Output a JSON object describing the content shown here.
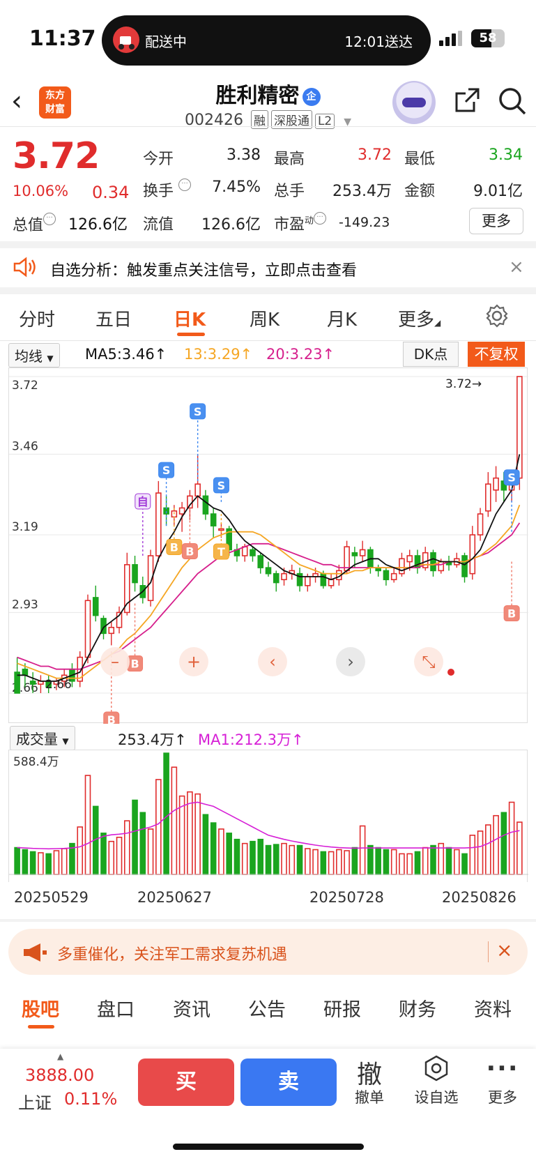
{
  "status": {
    "time": "11:37",
    "delivery": "配送中",
    "eta": "12:01送达",
    "battery": "58"
  },
  "header": {
    "logo_line1": "东方",
    "logo_line2": "财富",
    "name": "胜利精密",
    "cert": "企",
    "code": "002426",
    "tags": [
      "融",
      "深股通",
      "L2"
    ]
  },
  "quote": {
    "price": "3.72",
    "pct": "10.06%",
    "change": "0.34",
    "open_label": "今开",
    "open": "3.38",
    "high_label": "最高",
    "high": "3.72",
    "low_label": "最低",
    "low": "3.34",
    "turnover_label": "换手",
    "turnover": "7.45%",
    "volume_label": "总手",
    "volume": "253.4万",
    "amount_label": "金额",
    "amount": "9.01亿",
    "mktcap_label": "总值",
    "mktcap": "126.6亿",
    "float_label": "流值",
    "float": "126.6亿",
    "pe_label": "市盈",
    "pe_sup": "动",
    "pe": "-149.23",
    "more": "更多"
  },
  "alert": {
    "text": "自选分析：触发重点关注信号，立即点击查看"
  },
  "tabs": [
    "分时",
    "五日",
    "日K",
    "周K",
    "月K",
    "更多"
  ],
  "chart_toolbar": {
    "ma_select": "均线",
    "ma5": "MA5:3.46↑",
    "ma13": "13:3.29↑",
    "ma20": "20:3.23↑",
    "dk": "DK点",
    "adjust": "不复权"
  },
  "price_chart": {
    "y_labels": [
      "3.72",
      "3.46",
      "3.19",
      "2.93",
      "2.66"
    ],
    "last_label": "3.72",
    "low_label": "2.66",
    "marker_self": "自",
    "buy_mark": "B",
    "sell_mark": "S",
    "t_mark": "T"
  },
  "volume_toolbar": {
    "select": "成交量",
    "vol": "253.4万↑",
    "ma1": "MA1:212.3万↑",
    "max_label": "588.4万"
  },
  "chart_data": {
    "type": "candlestick",
    "x_ticks": [
      "20250529",
      "20250627",
      "20250728",
      "20250826"
    ],
    "ylim": [
      2.66,
      3.72
    ],
    "ohlc": [
      [
        2.73,
        2.78,
        2.7,
        2.66
      ],
      [
        2.74,
        2.76,
        2.68,
        2.72
      ],
      [
        2.7,
        2.73,
        2.66,
        2.69
      ],
      [
        2.69,
        2.72,
        2.66,
        2.7
      ],
      [
        2.7,
        2.72,
        2.66,
        2.68
      ],
      [
        2.69,
        2.71,
        2.67,
        2.7
      ],
      [
        2.7,
        2.74,
        2.68,
        2.72
      ],
      [
        2.74,
        2.76,
        2.68,
        2.7
      ],
      [
        2.7,
        2.8,
        2.68,
        2.78
      ],
      [
        2.78,
        2.99,
        2.76,
        2.97
      ],
      [
        2.98,
        3.02,
        2.9,
        2.92
      ],
      [
        2.91,
        2.92,
        2.84,
        2.86
      ],
      [
        2.86,
        2.9,
        2.82,
        2.88
      ],
      [
        2.88,
        2.95,
        2.86,
        2.93
      ],
      [
        2.93,
        3.13,
        2.92,
        3.09
      ],
      [
        3.09,
        3.12,
        3.0,
        3.03
      ],
      [
        3.02,
        3.05,
        2.96,
        2.98
      ],
      [
        2.97,
        3.14,
        2.95,
        3.12
      ],
      [
        3.12,
        3.37,
        3.1,
        3.33
      ],
      [
        3.28,
        3.32,
        3.22,
        3.26
      ],
      [
        3.25,
        3.29,
        3.22,
        3.27
      ],
      [
        3.26,
        3.3,
        3.2,
        3.28
      ],
      [
        3.28,
        3.34,
        3.24,
        3.32
      ],
      [
        3.32,
        3.46,
        3.28,
        3.36
      ],
      [
        3.32,
        3.34,
        3.24,
        3.26
      ],
      [
        3.26,
        3.28,
        3.18,
        3.22
      ],
      [
        3.21,
        3.23,
        3.18,
        3.21
      ],
      [
        3.21,
        3.22,
        3.12,
        3.14
      ],
      [
        3.14,
        3.16,
        3.1,
        3.12
      ],
      [
        3.12,
        3.16,
        3.1,
        3.15
      ],
      [
        3.14,
        3.15,
        3.1,
        3.12
      ],
      [
        3.12,
        3.13,
        3.06,
        3.08
      ],
      [
        3.08,
        3.1,
        3.05,
        3.06
      ],
      [
        3.06,
        3.07,
        3.0,
        3.03
      ],
      [
        3.04,
        3.08,
        3.02,
        3.06
      ],
      [
        3.06,
        3.09,
        3.04,
        3.07
      ],
      [
        3.06,
        3.08,
        3.0,
        3.02
      ],
      [
        3.02,
        3.06,
        3.0,
        3.05
      ],
      [
        3.05,
        3.08,
        3.03,
        3.06
      ],
      [
        3.06,
        3.07,
        3.01,
        3.02
      ],
      [
        3.02,
        3.06,
        3.01,
        3.04
      ],
      [
        3.04,
        3.09,
        3.02,
        3.07
      ],
      [
        3.07,
        3.17,
        3.06,
        3.15
      ],
      [
        3.13,
        3.15,
        3.08,
        3.12
      ],
      [
        3.12,
        3.17,
        3.1,
        3.14
      ],
      [
        3.14,
        3.15,
        3.06,
        3.08
      ],
      [
        3.08,
        3.09,
        3.05,
        3.07
      ],
      [
        3.07,
        3.08,
        3.02,
        3.04
      ],
      [
        3.04,
        3.08,
        3.03,
        3.06
      ],
      [
        3.06,
        3.13,
        3.05,
        3.11
      ],
      [
        3.1,
        3.14,
        3.07,
        3.12
      ],
      [
        3.12,
        3.14,
        3.06,
        3.08
      ],
      [
        3.08,
        3.15,
        3.07,
        3.13
      ],
      [
        3.13,
        3.14,
        3.05,
        3.07
      ],
      [
        3.07,
        3.11,
        3.06,
        3.1
      ],
      [
        3.1,
        3.12,
        3.07,
        3.09
      ],
      [
        3.09,
        3.13,
        3.08,
        3.11
      ],
      [
        3.12,
        3.13,
        3.03,
        3.05
      ],
      [
        3.06,
        3.22,
        3.04,
        3.19
      ],
      [
        3.19,
        3.28,
        3.17,
        3.26
      ],
      [
        3.27,
        3.4,
        3.25,
        3.36
      ],
      [
        3.34,
        3.42,
        3.3,
        3.38
      ],
      [
        3.37,
        3.4,
        3.3,
        3.34
      ],
      [
        3.34,
        3.4,
        3.3,
        3.37
      ],
      [
        3.38,
        3.72,
        3.34,
        3.72
      ]
    ],
    "ma5": [
      2.72,
      2.72,
      2.71,
      2.7,
      2.7,
      2.7,
      2.71,
      2.72,
      2.73,
      2.78,
      2.83,
      2.88,
      2.9,
      2.92,
      2.96,
      2.98,
      3.0,
      3.03,
      3.11,
      3.16,
      3.2,
      3.25,
      3.29,
      3.32,
      3.3,
      3.28,
      3.27,
      3.24,
      3.2,
      3.17,
      3.15,
      3.13,
      3.11,
      3.09,
      3.07,
      3.06,
      3.05,
      3.05,
      3.05,
      3.05,
      3.04,
      3.05,
      3.07,
      3.09,
      3.1,
      3.11,
      3.11,
      3.09,
      3.08,
      3.07,
      3.08,
      3.09,
      3.1,
      3.11,
      3.1,
      3.1,
      3.1,
      3.09,
      3.11,
      3.14,
      3.2,
      3.26,
      3.3,
      3.34,
      3.46
    ],
    "ma13": [
      2.76,
      2.75,
      2.74,
      2.73,
      2.72,
      2.71,
      2.71,
      2.71,
      2.71,
      2.73,
      2.75,
      2.77,
      2.79,
      2.81,
      2.84,
      2.86,
      2.89,
      2.92,
      2.96,
      3.0,
      3.04,
      3.08,
      3.11,
      3.14,
      3.16,
      3.18,
      3.19,
      3.2,
      3.2,
      3.2,
      3.2,
      3.19,
      3.17,
      3.15,
      3.13,
      3.11,
      3.09,
      3.08,
      3.07,
      3.06,
      3.06,
      3.06,
      3.06,
      3.07,
      3.07,
      3.08,
      3.08,
      3.08,
      3.08,
      3.08,
      3.08,
      3.09,
      3.09,
      3.09,
      3.1,
      3.1,
      3.1,
      3.1,
      3.11,
      3.12,
      3.14,
      3.16,
      3.19,
      3.22,
      3.29
    ],
    "ma20": [
      2.78,
      2.77,
      2.76,
      2.75,
      2.75,
      2.74,
      2.74,
      2.74,
      2.74,
      2.75,
      2.76,
      2.77,
      2.79,
      2.8,
      2.82,
      2.84,
      2.86,
      2.88,
      2.91,
      2.94,
      2.97,
      3.0,
      3.03,
      3.06,
      3.08,
      3.1,
      3.12,
      3.13,
      3.14,
      3.15,
      3.16,
      3.16,
      3.16,
      3.15,
      3.14,
      3.13,
      3.12,
      3.11,
      3.1,
      3.09,
      3.09,
      3.08,
      3.08,
      3.08,
      3.08,
      3.08,
      3.08,
      3.08,
      3.08,
      3.08,
      3.08,
      3.08,
      3.09,
      3.09,
      3.09,
      3.1,
      3.1,
      3.1,
      3.11,
      3.12,
      3.13,
      3.15,
      3.17,
      3.19,
      3.23
    ],
    "volume_max": 588.4,
    "volume": [
      130,
      120,
      110,
      105,
      100,
      115,
      125,
      150,
      230,
      480,
      330,
      200,
      160,
      180,
      260,
      360,
      300,
      220,
      460,
      588,
      520,
      380,
      400,
      390,
      290,
      250,
      220,
      200,
      170,
      150,
      160,
      170,
      140,
      145,
      150,
      140,
      140,
      125,
      120,
      110,
      110,
      120,
      115,
      130,
      235,
      140,
      130,
      120,
      120,
      100,
      100,
      110,
      130,
      140,
      150,
      130,
      120,
      100,
      190,
      210,
      240,
      285,
      300,
      350,
      253.4
    ],
    "ma1": [
      130,
      128,
      126,
      125,
      124,
      125,
      126,
      128,
      134,
      150,
      170,
      185,
      192,
      195,
      200,
      210,
      220,
      230,
      245,
      280,
      310,
      330,
      345,
      350,
      340,
      330,
      310,
      290,
      270,
      250,
      230,
      210,
      190,
      180,
      170,
      162,
      155,
      148,
      142,
      137,
      133,
      130,
      128,
      127,
      128,
      128,
      128,
      128,
      128,
      128,
      128,
      128,
      128,
      128,
      128,
      128,
      128,
      128,
      130,
      135,
      150,
      170,
      190,
      205,
      212.3
    ]
  },
  "zoom_buttons": [
    "–",
    "+",
    "‹",
    "›",
    "⤡"
  ],
  "banner": {
    "text": "多重催化，关注军工需求复苏机遇"
  },
  "bottom_tabs": [
    "股吧",
    "盘口",
    "资讯",
    "公告",
    "研报",
    "财务",
    "资料"
  ],
  "tradebar": {
    "index_value": "3888.00",
    "index_name": "上证",
    "index_pct": "0.11%",
    "buy": "买",
    "sell": "卖",
    "cancel_icon": "撤",
    "cancel": "撤单",
    "watch": "设自选",
    "more": "更多"
  },
  "colors": {
    "up": "#e02c2c",
    "down": "#1aa51f",
    "accent": "#f25a1a",
    "ma5": "#111111",
    "ma13": "#f5a623",
    "ma20": "#d61f8c",
    "ma1": "#d61fd6"
  }
}
